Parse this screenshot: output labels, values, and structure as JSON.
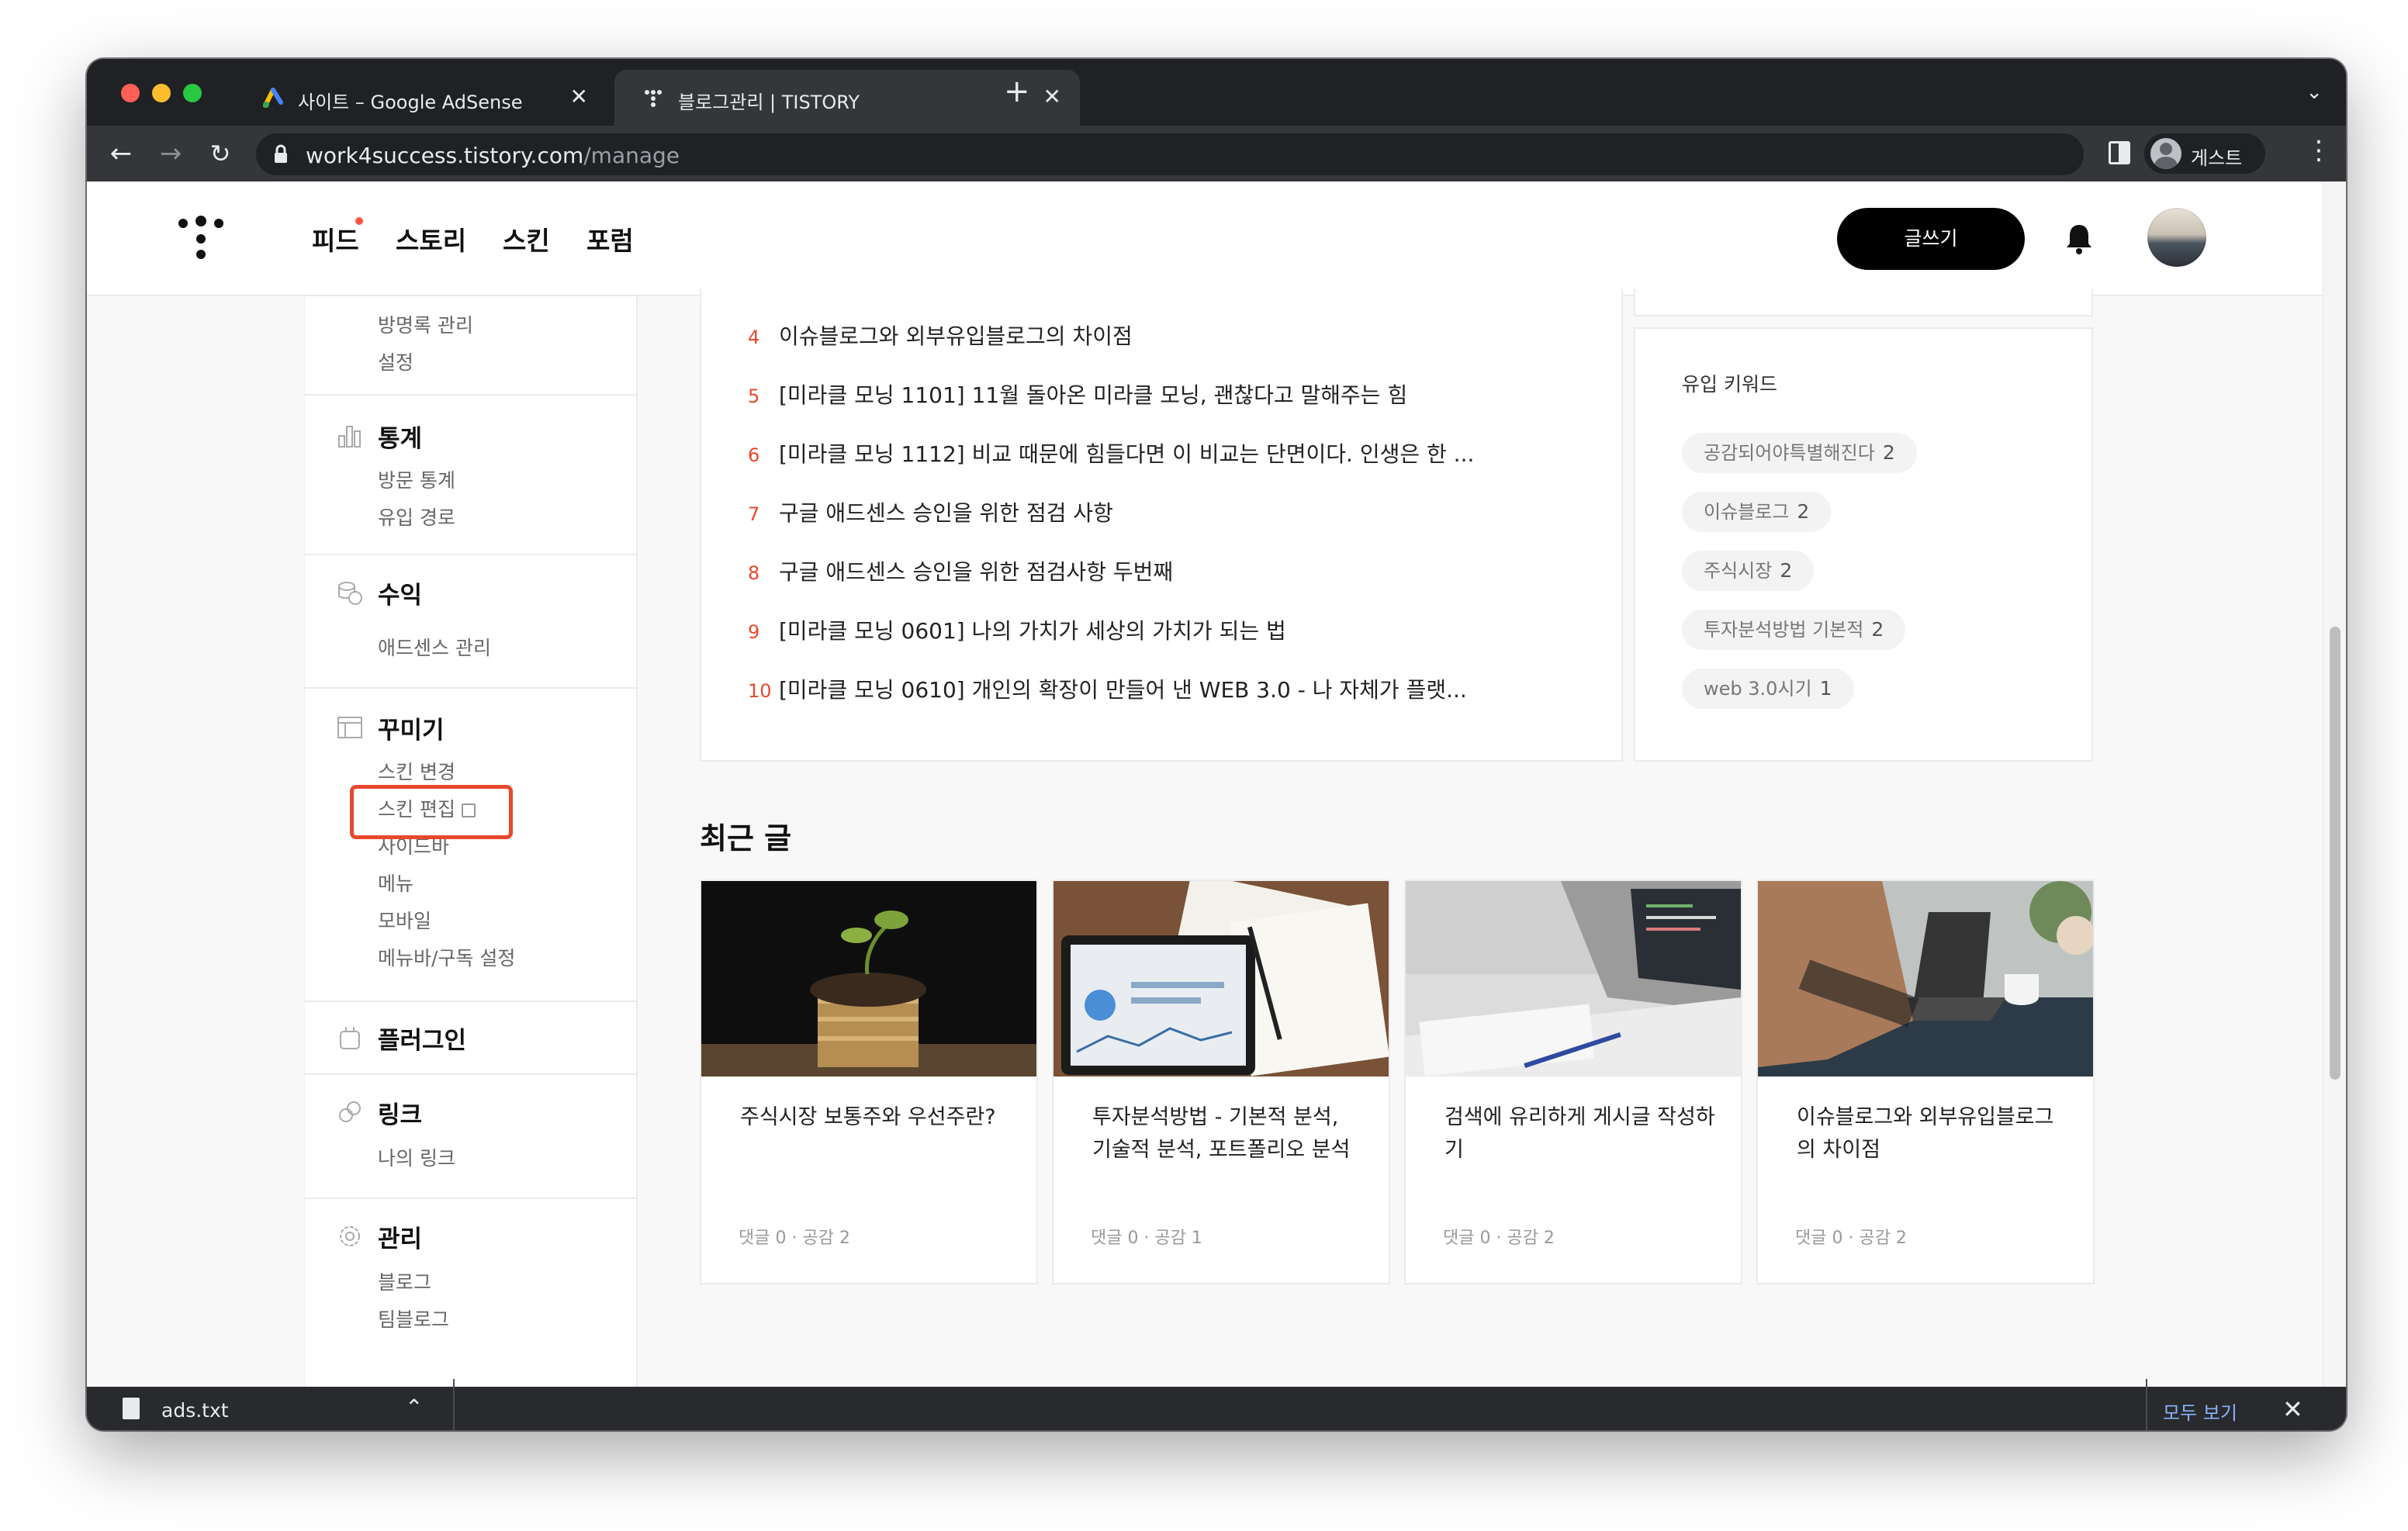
{
  "browser": {
    "tabs": [
      {
        "title": "사이트 – Google AdSense",
        "close": "✕"
      },
      {
        "title": "블로그관리 | TISTORY",
        "close": "✕"
      }
    ],
    "new_tab": "+",
    "tab_menu": "⌄",
    "url_host": "work4success.tistory.com",
    "url_path": "/manage",
    "profile_label": "게스트",
    "back": "←",
    "forward": "→",
    "reload": "↻",
    "menu": "⋮"
  },
  "header": {
    "nav": [
      "피드",
      "스토리",
      "스킨",
      "포럼"
    ],
    "write_button": "글쓰기"
  },
  "sidebar": {
    "top_items": [
      "방명록 관리",
      "설정"
    ],
    "stats": {
      "title": "통계",
      "items": [
        "방문 통계",
        "유입 경로"
      ]
    },
    "revenue": {
      "title": "수익",
      "items": [
        "애드센스 관리"
      ]
    },
    "design": {
      "title": "꾸미기",
      "items": [
        "스킨 변경",
        "스킨 편집",
        "사이드바",
        "메뉴",
        "모바일",
        "메뉴바/구독 설정"
      ]
    },
    "plugin": {
      "title": "플러그인"
    },
    "link": {
      "title": "링크",
      "items": [
        "나의 링크"
      ]
    },
    "manage": {
      "title": "관리",
      "items": [
        "블로그",
        "팀블로그"
      ]
    }
  },
  "popular_posts": [
    {
      "rank": "4",
      "title": "이슈블로그와 외부유입블로그의 차이점"
    },
    {
      "rank": "5",
      "title": "[미라클 모닝 1101] 11월 돌아온 미라클 모닝, 괜찮다고 말해주는 힘"
    },
    {
      "rank": "6",
      "title": "[미라클 모닝 1112] 비교 때문에 힘들다면 이 비교는 단면이다. 인생은 한 ..."
    },
    {
      "rank": "7",
      "title": "구글 애드센스 승인을 위한 점검 사항"
    },
    {
      "rank": "8",
      "title": "구글 애드센스 승인을 위한 점검사항 두번째"
    },
    {
      "rank": "9",
      "title": "[미라클 모닝 0601] 나의 가치가 세상의 가치가 되는 법"
    },
    {
      "rank": "10",
      "title": "[미라클 모닝 0610] 개인의 확장이 만들어 낸 WEB 3.0 - 나 자체가 플랫..."
    }
  ],
  "keywords": {
    "title": "유입 키워드",
    "items": [
      {
        "label": "공감되어야특별해진다",
        "count": "2"
      },
      {
        "label": "이슈블로그",
        "count": "2"
      },
      {
        "label": "주식시장",
        "count": "2"
      },
      {
        "label": "투자분석방법 기본적",
        "count": "2"
      },
      {
        "label": "web 3.0시기",
        "count": "1"
      }
    ]
  },
  "recent": {
    "title": "최근 글",
    "posts": [
      {
        "title": "주식시장 보통주와 우선주란?",
        "meta": "댓글 0 · 공감 2"
      },
      {
        "title": "투자분석방법 - 기본적 분석, 기술적 분석, 포트폴리오 분석",
        "meta": "댓글 0 · 공감 1"
      },
      {
        "title": "검색에 유리하게 게시글 작성하기",
        "meta": "댓글 0 · 공감 2"
      },
      {
        "title": "이슈블로그와 외부유입블로그의 차이점",
        "meta": "댓글 0 · 공감 2"
      }
    ]
  },
  "download": {
    "filename": "ads.txt",
    "caret": "⌃",
    "show_all": "모두 보기",
    "close": "✕"
  },
  "colors": {
    "accent_red": "#e8482c",
    "highlight_box": "#e8482c",
    "download_link": "#8ab4f8"
  }
}
